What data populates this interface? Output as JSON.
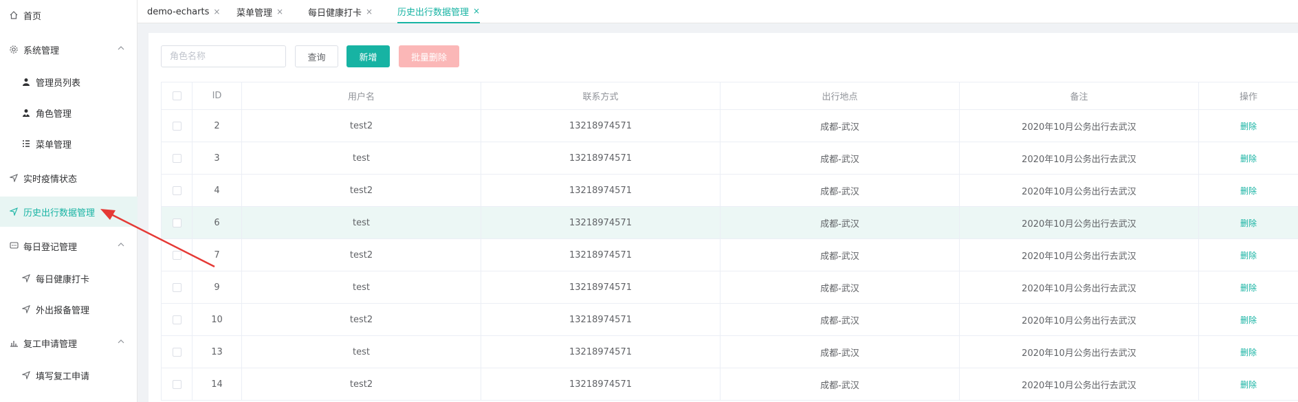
{
  "sidebar": {
    "items": [
      {
        "label": "首页",
        "icon": "home-icon"
      },
      {
        "label": "系统管理",
        "icon": "gear-icon"
      },
      {
        "label": "管理员列表",
        "icon": "user-icon"
      },
      {
        "label": "角色管理",
        "icon": "role-icon"
      },
      {
        "label": "菜单管理",
        "icon": "list-icon"
      },
      {
        "label": "实时疫情状态",
        "icon": "send-icon"
      },
      {
        "label": "历史出行数据管理",
        "icon": "send-icon"
      },
      {
        "label": "每日登记管理",
        "icon": "chat-icon"
      },
      {
        "label": "每日健康打卡",
        "icon": "send-icon"
      },
      {
        "label": "外出报备管理",
        "icon": "send-icon"
      },
      {
        "label": "复工申请管理",
        "icon": "chart-icon"
      },
      {
        "label": "填写复工申请",
        "icon": "send-icon"
      }
    ]
  },
  "tabs": [
    {
      "label": "demo-echarts",
      "close": "×"
    },
    {
      "label": "菜单管理",
      "close": "×"
    },
    {
      "label": "每日健康打卡",
      "close": "×"
    },
    {
      "label": "历史出行数据管理",
      "close": "×"
    }
  ],
  "toolbar": {
    "search_placeholder": "角色名称",
    "query_label": "查询",
    "add_label": "新增",
    "batch_delete_label": "批量删除"
  },
  "table": {
    "headers": [
      "ID",
      "用户名",
      "联系方式",
      "出行地点",
      "备注",
      "操作"
    ],
    "rows": [
      {
        "id": "2",
        "username": "test2",
        "contact": "13218974571",
        "location": "成都-武汉",
        "note": "2020年10月公务出行去武汉",
        "action": "删除"
      },
      {
        "id": "3",
        "username": "test",
        "contact": "13218974571",
        "location": "成都-武汉",
        "note": "2020年10月公务出行去武汉",
        "action": "删除"
      },
      {
        "id": "4",
        "username": "test2",
        "contact": "13218974571",
        "location": "成都-武汉",
        "note": "2020年10月公务出行去武汉",
        "action": "删除"
      },
      {
        "id": "6",
        "username": "test",
        "contact": "13218974571",
        "location": "成都-武汉",
        "note": "2020年10月公务出行去武汉",
        "action": "删除"
      },
      {
        "id": "7",
        "username": "test2",
        "contact": "13218974571",
        "location": "成都-武汉",
        "note": "2020年10月公务出行去武汉",
        "action": "删除"
      },
      {
        "id": "9",
        "username": "test",
        "contact": "13218974571",
        "location": "成都-武汉",
        "note": "2020年10月公务出行去武汉",
        "action": "删除"
      },
      {
        "id": "10",
        "username": "test2",
        "contact": "13218974571",
        "location": "成都-武汉",
        "note": "2020年10月公务出行去武汉",
        "action": "删除"
      },
      {
        "id": "13",
        "username": "test",
        "contact": "13218974571",
        "location": "成都-武汉",
        "note": "2020年10月公务出行去武汉",
        "action": "删除"
      },
      {
        "id": "14",
        "username": "test2",
        "contact": "13218974571",
        "location": "成都-武汉",
        "note": "2020年10月公务出行去武汉",
        "action": "删除"
      }
    ]
  },
  "colors": {
    "accent": "#17b3a3",
    "danger_disabled": "#fbb7b7",
    "annotation_arrow": "#e53935"
  }
}
